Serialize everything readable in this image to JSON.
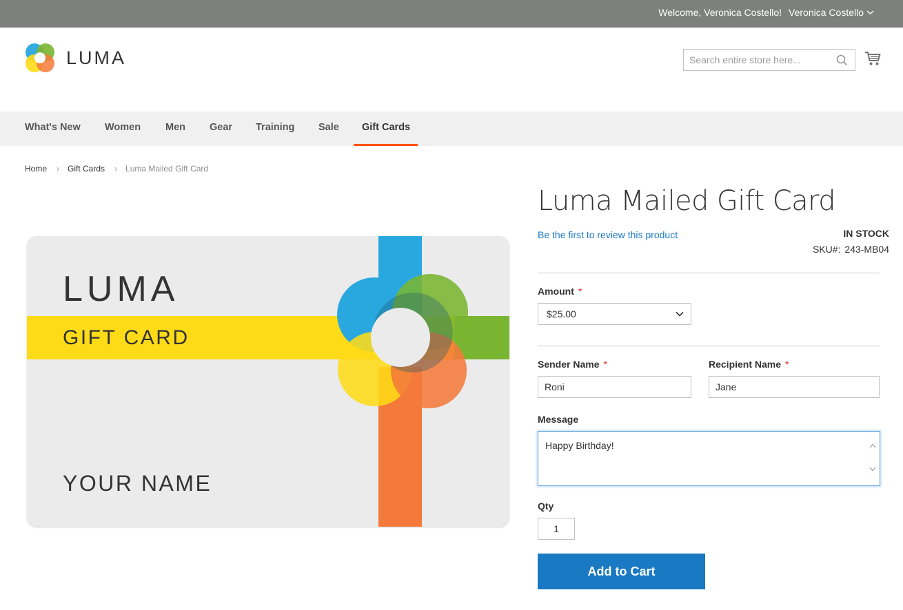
{
  "header": {
    "welcome_text": "Welcome, Veronica Costello!",
    "account_name": "Veronica Costello",
    "logo_text": "LUMA",
    "search_placeholder": "Search entire store here..."
  },
  "nav": {
    "items": [
      {
        "label": "What's New"
      },
      {
        "label": "Women"
      },
      {
        "label": "Men"
      },
      {
        "label": "Gear"
      },
      {
        "label": "Training"
      },
      {
        "label": "Sale"
      },
      {
        "label": "Gift Cards",
        "active": true
      }
    ]
  },
  "breadcrumb": {
    "items": [
      "Home",
      "Gift Cards",
      "Luma Mailed Gift Card"
    ]
  },
  "gift_card_image": {
    "brand": "LUMA",
    "subtitle": "GIFT CARD",
    "name_line": "YOUR NAME",
    "colors": {
      "blue": "#29a8e0",
      "yellow": "#fedb17",
      "green": "#79b530",
      "orange": "#f47a3b",
      "background": "#ebebeb"
    }
  },
  "product": {
    "title": "Luma Mailed Gift Card",
    "review_link": "Be the first to review this product",
    "stock_status": "IN STOCK",
    "sku_label": "SKU#:",
    "sku_value": "243-MB04"
  },
  "form": {
    "amount_label": "Amount",
    "amount_value": "$25.00",
    "sender_label": "Sender Name",
    "sender_value": "Roni",
    "recipient_label": "Recipient Name",
    "recipient_value": "Jane",
    "message_label": "Message",
    "message_value": "Happy Birthday!",
    "qty_label": "Qty",
    "qty_value": "1",
    "required_mark": "*",
    "add_to_cart_label": "Add to Cart"
  },
  "colors": {
    "accent": "#1979c3",
    "nav_active_underline": "#ff5501",
    "topbar": "#7e807e",
    "required": "#e02b27"
  }
}
